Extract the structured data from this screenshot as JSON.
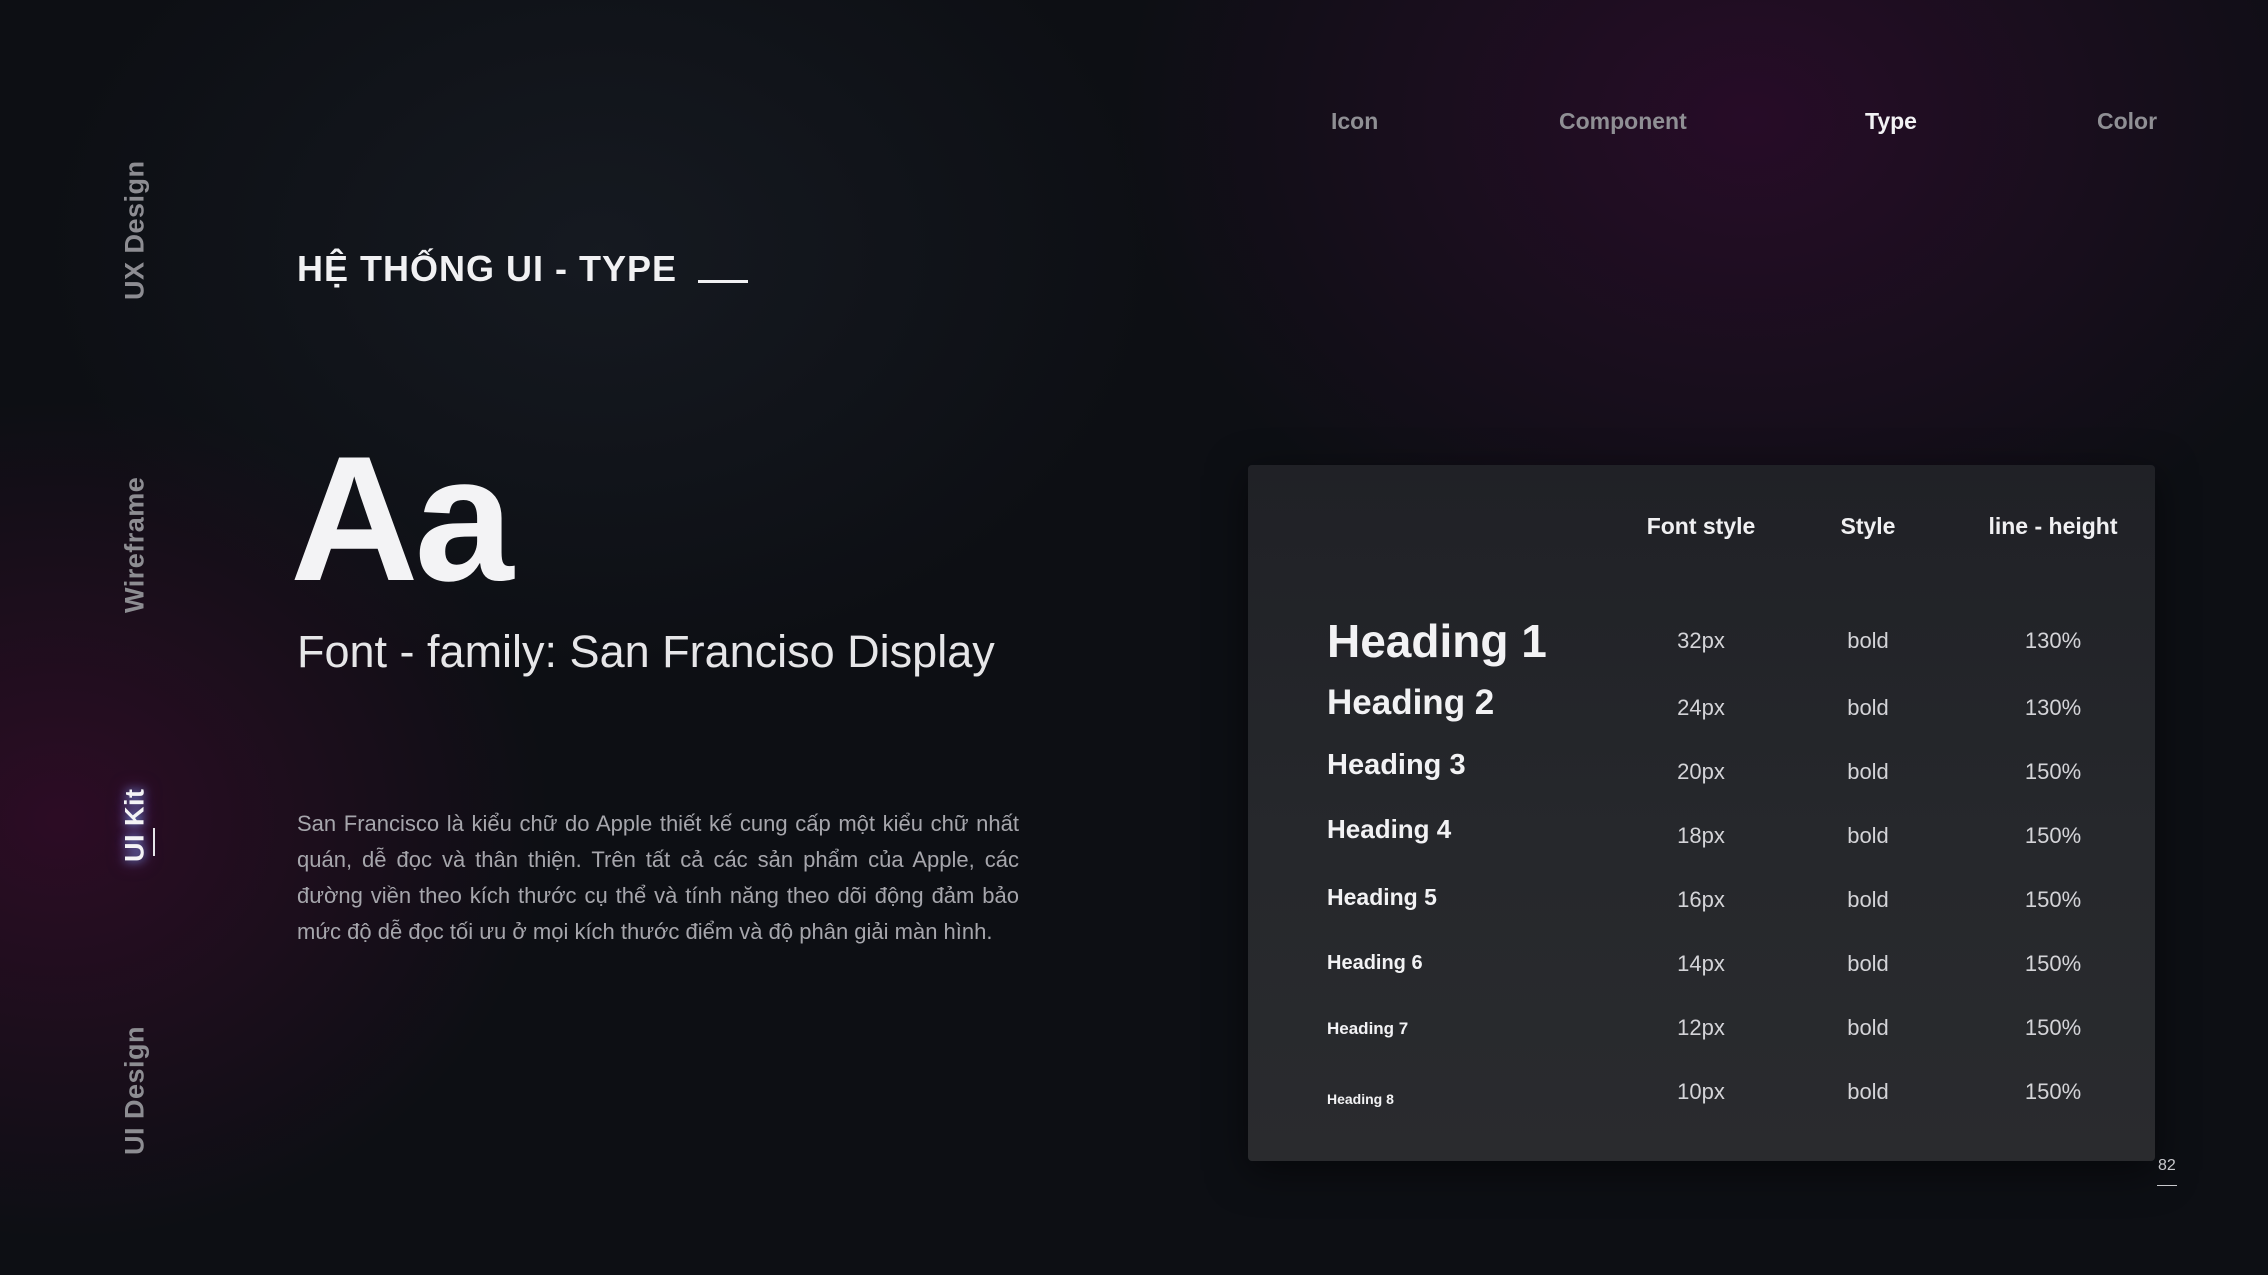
{
  "side_nav": {
    "items": [
      {
        "label": "UX Design",
        "active": false
      },
      {
        "label": "Wireframe",
        "active": false
      },
      {
        "label": "UI Kit",
        "active": true
      },
      {
        "label": "UI Design",
        "active": false
      }
    ]
  },
  "top_tabs": [
    {
      "label": "Icon",
      "active": false
    },
    {
      "label": "Component",
      "active": false
    },
    {
      "label": "Type",
      "active": true
    },
    {
      "label": "Color",
      "active": false
    }
  ],
  "section": {
    "title": "HỆ THỐNG UI - TYPE"
  },
  "specimen": {
    "glyphs": "Aa",
    "font_family": "Font - family: San Franciso Display",
    "description": "San Francisco là kiểu chữ do Apple thiết kế cung cấp một kiểu chữ nhất quán, dễ đọc và thân thiện. Trên tất cả các sản phẩm của Apple, các đường viền theo kích thước cụ thể và tính năng theo dõi động đảm bảo mức độ dễ đọc tối ưu ở mọi kích thước điểm và độ phân giải màn hình."
  },
  "type_table": {
    "headers": {
      "font_style": "Font style",
      "style": "Style",
      "line_height": "line - height"
    },
    "rows": [
      {
        "name": "Heading 1",
        "size": "32px",
        "style": "bold",
        "line_height": "130%"
      },
      {
        "name": "Heading 2",
        "size": "24px",
        "style": "bold",
        "line_height": "130%"
      },
      {
        "name": "Heading 3",
        "size": "20px",
        "style": "bold",
        "line_height": "150%"
      },
      {
        "name": "Heading 4",
        "size": "18px",
        "style": "bold",
        "line_height": "150%"
      },
      {
        "name": "Heading 5",
        "size": "16px",
        "style": "bold",
        "line_height": "150%"
      },
      {
        "name": "Heading 6",
        "size": "14px",
        "style": "bold",
        "line_height": "150%"
      },
      {
        "name": "Heading 7",
        "size": "12px",
        "style": "bold",
        "line_height": "150%"
      },
      {
        "name": "Heading 8",
        "size": "10px",
        "style": "bold",
        "line_height": "150%"
      }
    ]
  },
  "page_number": "82",
  "colors": {
    "background": "#0d0f14",
    "card": "#25262a",
    "accent_glow": "#7aa8ff",
    "text_primary": "#f2f2f4",
    "text_muted": "#8f8f94"
  }
}
